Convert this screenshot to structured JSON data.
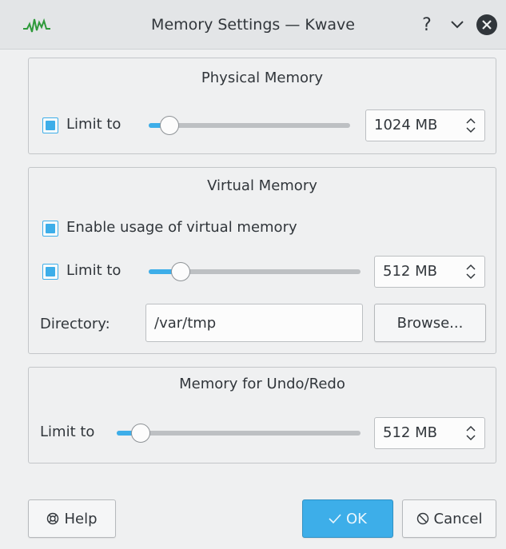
{
  "window": {
    "title": "Memory Settings — Kwave",
    "help_glyph": "?",
    "minimize_glyph": "∨",
    "close_glyph": "✕",
    "accent_color": "#3daee9"
  },
  "physical": {
    "title": "Physical Memory",
    "limit_label": "Limit to",
    "limit_checked": true,
    "slider_level": 0.11,
    "value": "1024 MB"
  },
  "virtual": {
    "title": "Virtual Memory",
    "enable_label": "Enable usage of virtual memory",
    "enable_checked": true,
    "limit_label": "Limit to",
    "limit_checked": true,
    "slider_level": 0.16,
    "value": "512 MB",
    "directory_label": "Directory:",
    "directory_value": "/var/tmp",
    "browse_label": "Browse..."
  },
  "undo": {
    "title": "Memory for Undo/Redo",
    "limit_label": "Limit to",
    "slider_level": 0.1,
    "value": "512 MB"
  },
  "footer": {
    "help_label": "Help",
    "ok_label": "OK",
    "cancel_label": "Cancel"
  }
}
